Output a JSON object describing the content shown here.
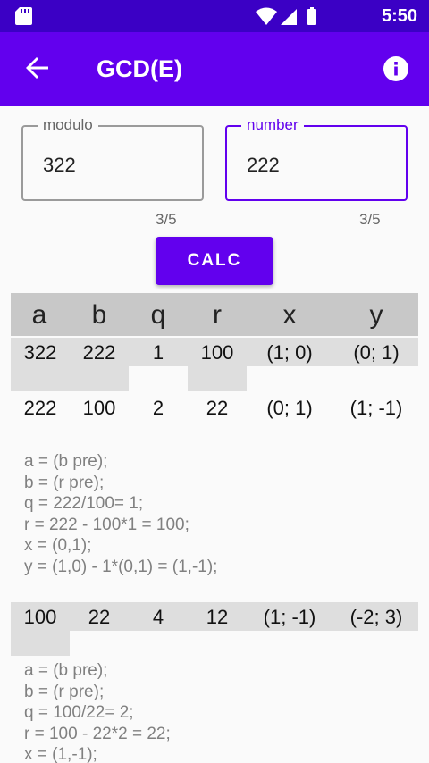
{
  "status_bar": {
    "time": "5:50",
    "icons": [
      "sd-card-icon",
      "wifi-icon",
      "signal-icon",
      "battery-icon"
    ]
  },
  "app_bar": {
    "title": "GCD(E)"
  },
  "form": {
    "modulo": {
      "label": "modulo",
      "value": "322",
      "counter": "3/5"
    },
    "number": {
      "label": "number",
      "value": "222",
      "counter": "3/5"
    },
    "calc_label": "CALC"
  },
  "table": {
    "headers": [
      "a",
      "b",
      "q",
      "r",
      "x",
      "y"
    ],
    "rows": [
      {
        "a": "322",
        "b": "222",
        "q": "1",
        "r": "100",
        "x": "(1; 0)",
        "y": "(0; 1)"
      },
      {
        "a": "222",
        "b": "100",
        "q": "2",
        "r": "22",
        "x": "(0; 1)",
        "y": "(1; -1)",
        "explanation": [
          "a = (b pre);",
          "b = (r pre);",
          "q = 222/100= 1;",
          "r = 222 - 100*1 = 100;",
          "x = (0,1);",
          "y = (1,0) - 1*(0,1) = (1,-1);"
        ]
      },
      {
        "a": "100",
        "b": "22",
        "q": "4",
        "r": "12",
        "x": "(1; -1)",
        "y": "(-2; 3)",
        "explanation": [
          "a = (b pre);",
          "b = (r pre);",
          "q = 100/22= 2;",
          "r = 100 - 22*2 = 22;",
          "x = (1,-1);"
        ]
      }
    ]
  },
  "colors": {
    "primary": "#6200ee",
    "status_bar": "#3b00c5",
    "header_bg": "#c8c8c8",
    "cell_bg": "#dedede"
  }
}
